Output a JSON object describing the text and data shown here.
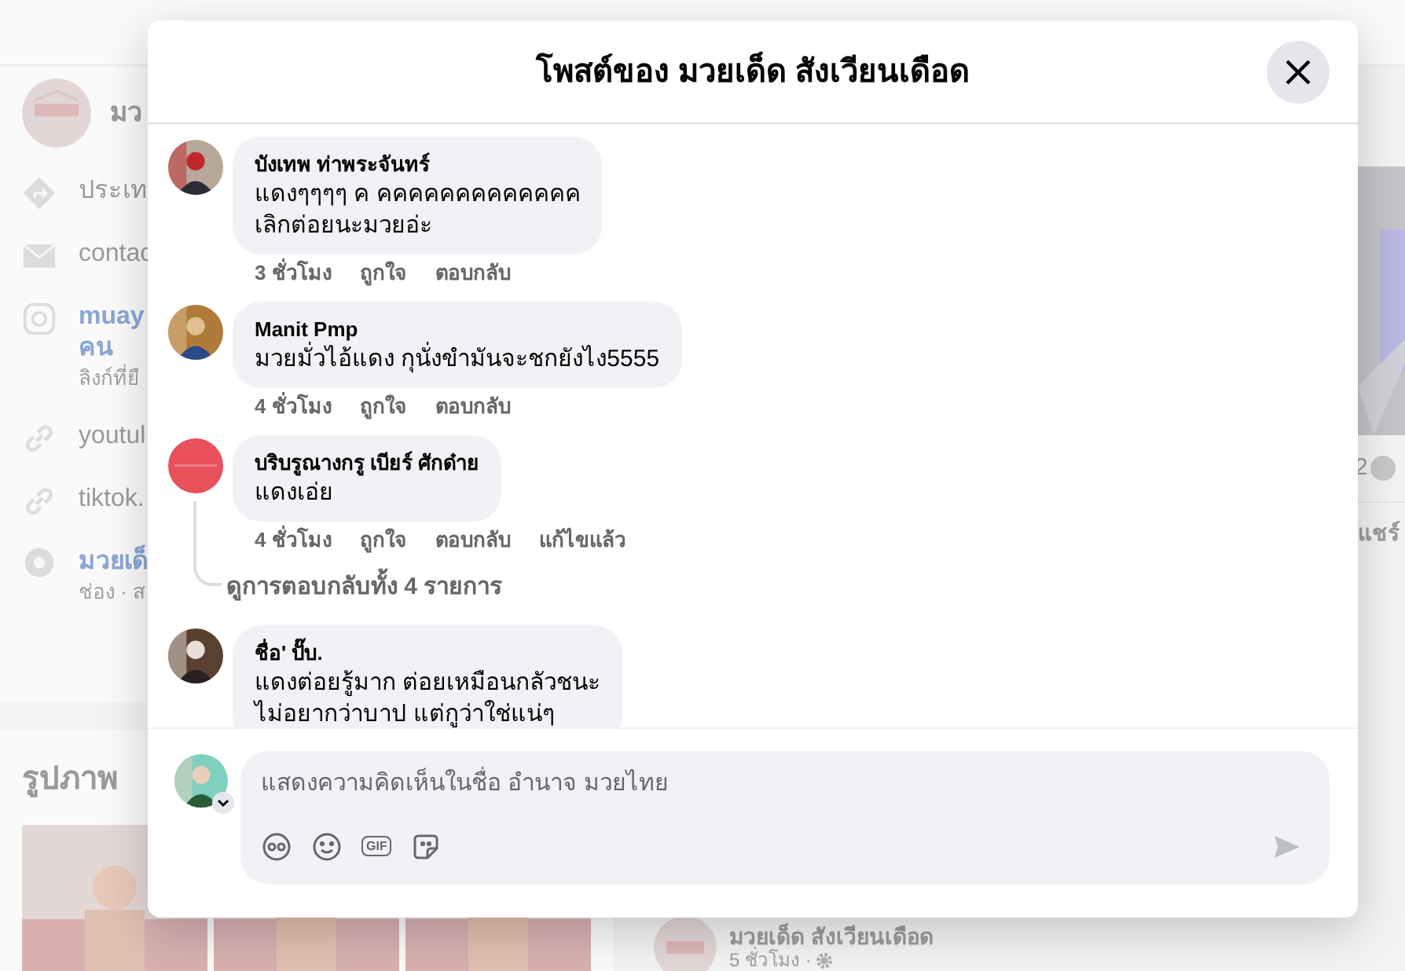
{
  "background": {
    "page_name": "มว",
    "about": [
      {
        "kind": "share",
        "text": "ประเท"
      },
      {
        "kind": "mail",
        "text": "contac"
      },
      {
        "kind": "instagram",
        "text": "muay",
        "line2": "คน",
        "sub": "ลิงก์ที่ยื"
      },
      {
        "kind": "link",
        "text": "youtul"
      },
      {
        "kind": "link",
        "text": "tiktok."
      },
      {
        "kind": "channel",
        "text": "มวยเด็",
        "sub": "ช่อง · ส"
      }
    ],
    "photos_title": "รูปภาพ",
    "right_count": "2",
    "right_share": "แชร์",
    "post_author": "มวยเด็ด สังเวียนเดือด",
    "post_time": "5 ชั่วโมง ·"
  },
  "dialog": {
    "title": "โพสต์ของ มวยเด็ด สังเวียนเดือด",
    "comments": [
      {
        "author": "บังเทพ ท่าพระจันทร์",
        "lines": [
          "แดงๆๆๆๆ ค คคคคคคคคคคคคค",
          "เลิกต่อยนะมวยอ่ะ"
        ],
        "meta": [
          "3 ชั่วโมง",
          "ถูกใจ",
          "ตอบกลับ"
        ]
      },
      {
        "author": "Manit Pmp",
        "lines": [
          "มวยมั่วไอ้แดง กุนั่งขำมันจะชกยังไง5555"
        ],
        "meta": [
          "4 ชั่วโมง",
          "ถูกใจ",
          "ตอบกลับ"
        ]
      },
      {
        "author": "บริบรูณางกรู เบียร์ ศักด๋าย",
        "lines": [
          "แดงเอ่ย"
        ],
        "meta": [
          "4 ชั่วโมง",
          "ถูกใจ",
          "ตอบกลับ",
          "แก้ไขแล้ว"
        ],
        "replies": "ดูการตอบกลับทั้ง 4 รายการ"
      },
      {
        "author": "ชื่อ' ปั๊บ.",
        "lines": [
          "แดงต่อยรู้มาก ต่อยเหมือนกลัวชนะ",
          "ไม่อยากว่าบาป แต่กูว่าใช่แน่ๆ"
        ]
      }
    ],
    "composer": {
      "placeholder": "แสดงความคิดเห็นในชื่อ อำนาจ มวยไทย",
      "gif": "GIF"
    }
  }
}
